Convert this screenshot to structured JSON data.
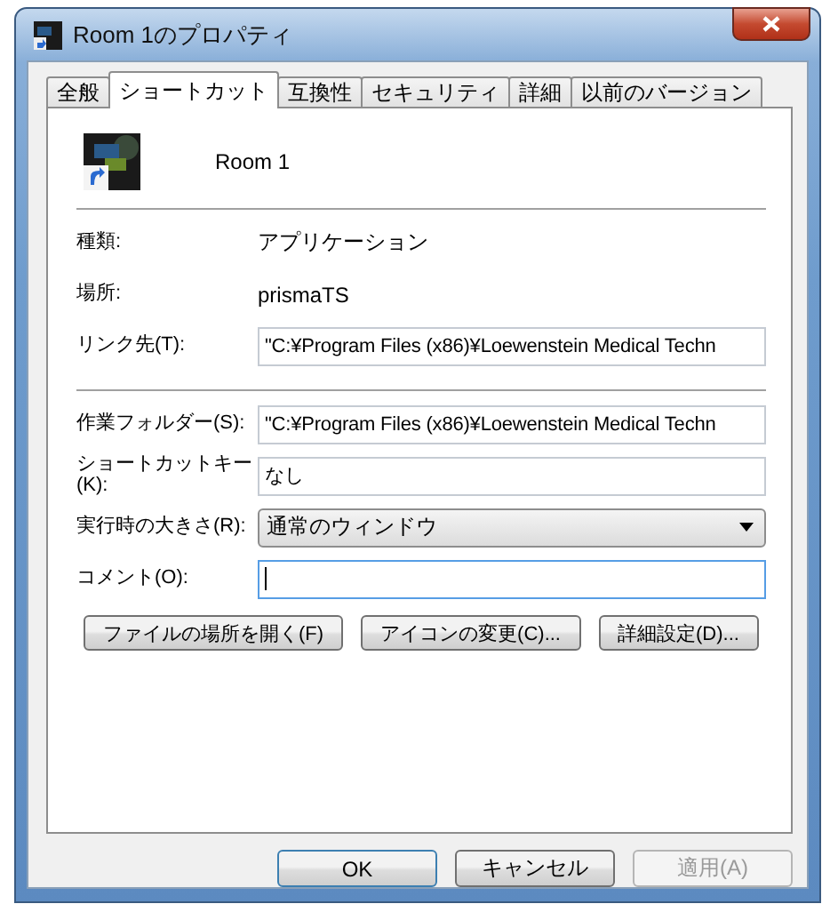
{
  "window": {
    "title": "Room 1のプロパティ"
  },
  "tabs": [
    {
      "label": "全般",
      "selected": false
    },
    {
      "label": "ショートカット",
      "selected": true
    },
    {
      "label": "互換性",
      "selected": false
    },
    {
      "label": "セキュリティ",
      "selected": false
    },
    {
      "label": "詳細",
      "selected": false
    },
    {
      "label": "以前のバージョン",
      "selected": false
    }
  ],
  "shortcut": {
    "name": "Room 1"
  },
  "info_rows": [
    {
      "kind": "text",
      "label": "種類:",
      "value": "アプリケーション"
    },
    {
      "kind": "text",
      "label": "場所:",
      "value": "prismaTS"
    },
    {
      "kind": "field",
      "label": "リンク先(T):",
      "value": "\"C:¥Program Files (x86)¥Loewenstein Medical Techn",
      "focused": false
    }
  ],
  "setting_rows": [
    {
      "kind": "field",
      "label": "作業フォルダー(S):",
      "value": "\"C:¥Program Files (x86)¥Loewenstein Medical Techn",
      "focused": false
    },
    {
      "kind": "field",
      "label": "ショートカットキー(K):",
      "value": "なし",
      "focused": false
    },
    {
      "kind": "select",
      "label": "実行時の大きさ(R):",
      "value": "通常のウィンドウ",
      "focused": false
    },
    {
      "kind": "field",
      "label": "コメント(O):",
      "value": "",
      "focused": true
    }
  ],
  "action_buttons": [
    "ファイルの場所を開く(F)",
    "アイコンの変更(C)...",
    "詳細設定(D)..."
  ],
  "dialog_buttons": [
    {
      "label": "OK",
      "default": true,
      "disabled": false
    },
    {
      "label": "キャンセル",
      "default": false,
      "disabled": false
    },
    {
      "label": "適用(A)",
      "default": false,
      "disabled": true
    }
  ]
}
